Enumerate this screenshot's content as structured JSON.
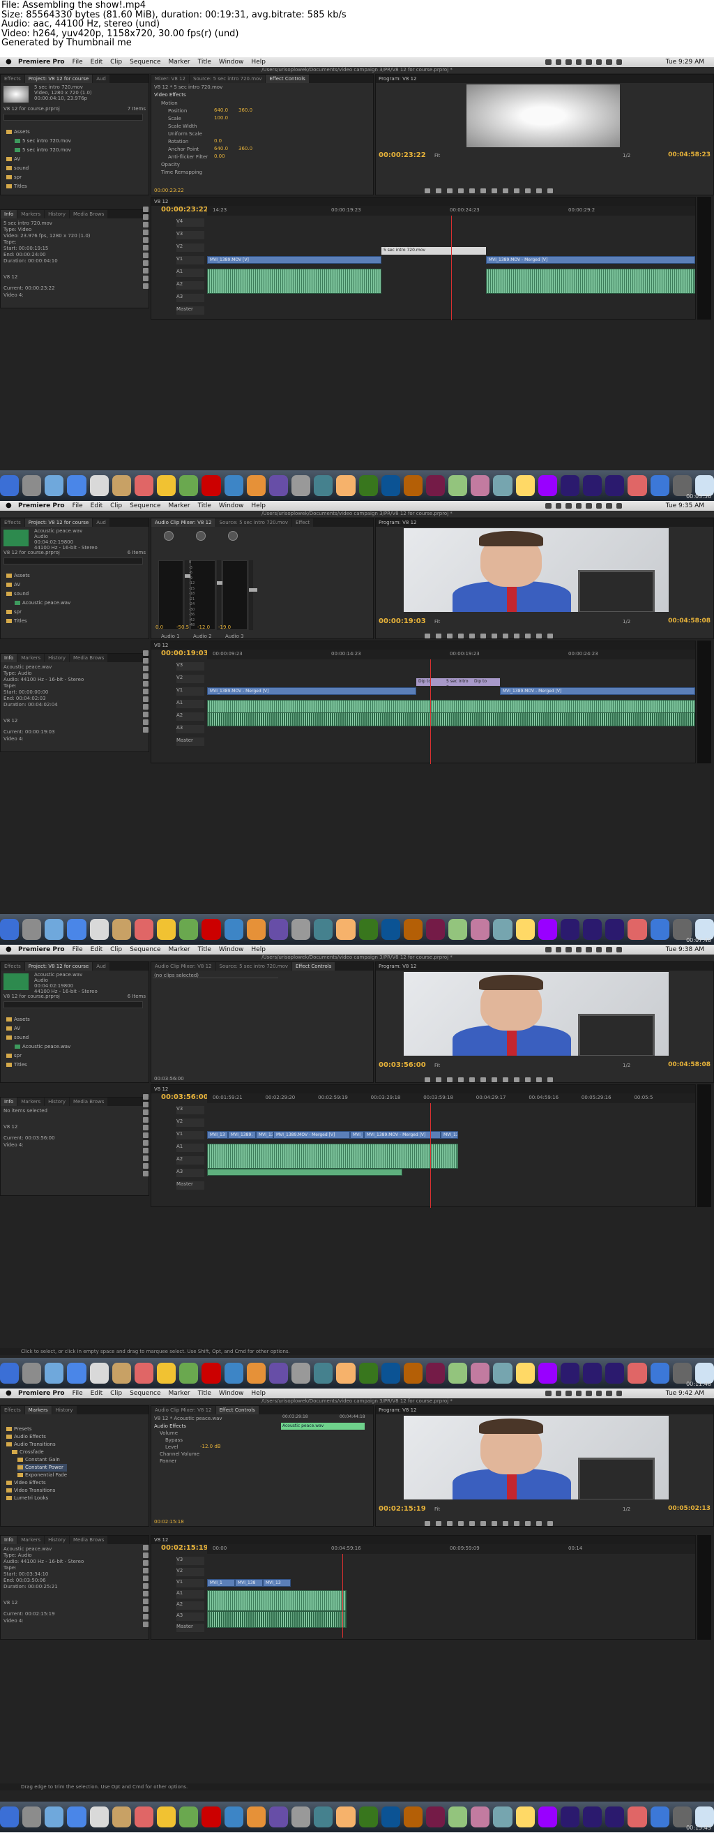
{
  "header": {
    "file": "File: Assembling the show!.mp4",
    "size": "Size: 85564330 bytes (81.60 MiB), duration: 00:19:31, avg.bitrate: 585 kb/s",
    "audio": "Audio: aac, 44100 Hz, stereo (und)",
    "video": "Video: h264, yuv420p, 1158x720, 30.00 fps(r) (und)",
    "generated": "Generated by Thumbnail me"
  },
  "menu": [
    "Premiere Pro",
    "File",
    "Edit",
    "Clip",
    "Sequence",
    "Marker",
    "Title",
    "Window",
    "Help"
  ],
  "path": "/Users/urisoplowek/Documents/video campaign 3/PR/V8 12 for course.prproj *",
  "frames": [
    {
      "clock": "Tue 9:29 AM",
      "stamp": "00:03:56",
      "tabs_left": [
        "Effects",
        "Project: V8 12 for course",
        "Aud"
      ],
      "tabs_mid": [
        "Mixer: V8 12",
        "Source: 5 sec intro 720.mov",
        "Effect Controls"
      ],
      "clip": {
        "name": "5 sec intro 720.mov",
        "info1": "Video, 1280 x 720 (1.0)",
        "info2": "00:00:04:10, 23.976p",
        "project": "V8 12 for course.prproj",
        "items": "7 Items"
      },
      "tree": [
        "Assets",
        "5 sec intro 720.mov",
        "5 sec intro 720.mov",
        "AV",
        "sound",
        "spr",
        "Titles"
      ],
      "fx": {
        "head": "V8 12 * 5 sec intro 720.mov",
        "section": "Video Effects",
        "rows": [
          "Motion",
          "Position",
          "Scale",
          "Scale Width",
          "Uniform Scale",
          "Rotation",
          "Anchor Point",
          "Anti-flicker Filter",
          "Opacity",
          "Time Remapping"
        ],
        "values": [
          "640.0",
          "360.0",
          "100.0",
          "0.0",
          "640.0",
          "360.0",
          "0.00"
        ],
        "tc": "00:00:23:22"
      },
      "program": {
        "label": "Program: V8 12",
        "tc_in": "00:00:23:22",
        "tc_out": "00:04:58:23",
        "fit": "Fit",
        "ratio": "1/2"
      },
      "seq": {
        "name": "V8 12",
        "tc": "00:00:23:22",
        "ticks": [
          "14:23",
          "00:00:19:23",
          "00:00:24:23",
          "00:00:29:2"
        ]
      },
      "title_clip": "5 sec intro 720.mov",
      "vclips": [
        "MVI_1389.MOV [V]",
        "MVI_1389.MOV - Merged [V]"
      ],
      "info": {
        "name": "5 sec intro 720.mov",
        "type": "Type: Video",
        "video": "Video: 23.976 fps, 1280 x 720 (1.0)",
        "tape": "Tape:",
        "start": "Start: 00:00:19:15",
        "end": "End: 00:00:24:00",
        "dur": "Duration: 00:00:04:10",
        "seq": "V8 12",
        "current": "Current: 00:00:23:22",
        "video4": "Video 4:"
      },
      "tracks": [
        "V4",
        "V3",
        "V2",
        "V1",
        "A1",
        "A2",
        "A3",
        "Master"
      ]
    },
    {
      "clock": "Tue 9:35 AM",
      "stamp": "00:07:48",
      "tabs_left": [
        "Effects",
        "Project: V8 12 for course",
        "Aud"
      ],
      "tabs_mid": [
        "Audio Clip Mixer: V8 12",
        "Source: 5 sec intro 720.mov",
        "Effect"
      ],
      "clip": {
        "name": "Acoustic peace.wav",
        "info1": "Audio",
        "info2": "00:04:02:19800",
        "info3": "44100 Hz - 16-bit - Stereo",
        "project": "V8 12 for course.prproj",
        "items": "6 Items"
      },
      "tree": [
        "Assets",
        "AV",
        "sound",
        "Acoustic peace.wav",
        "spr",
        "Titles"
      ],
      "mixer": {
        "vals": [
          "0.0",
          "-50.5",
          "-12.0",
          "-19.0"
        ],
        "lr": [
          "L",
          "R"
        ],
        "tracks": [
          "Audio 1",
          "Audio 2",
          "Audio 3"
        ],
        "scale": [
          "0",
          "-3",
          "-6",
          "-9",
          "-12",
          "-15",
          "-18",
          "-21",
          "-24",
          "-30",
          "-36",
          "-42",
          "-48"
        ]
      },
      "program": {
        "label": "Program: V8 12",
        "tc_in": "00:00:19:03",
        "tc_out": "00:04:58:08",
        "fit": "Fit",
        "ratio": "1/2"
      },
      "seq": {
        "name": "V8 12",
        "tc": "00:00:19:03",
        "ticks": [
          "00:00:09:23",
          "00:00:14:23",
          "00:00:19:23",
          "00:00:24:23"
        ]
      },
      "vclips": [
        "MVI_1389.MOV - Merged [V]",
        "MVI_1389.MOV - Merged [V]"
      ],
      "xclips": [
        "Dip to",
        "5 sec intro 7",
        "Dip to"
      ],
      "info": {
        "name": "Acoustic peace.wav",
        "type": "Type: Audio",
        "audio": "Audio: 44100 Hz - 16-bit - Stereo",
        "tape": "Tape:",
        "start": "Start: 00:00:00:00",
        "end": "End: 00:04:02:03",
        "dur": "Duration: 00:04:02:04",
        "seq": "V8 12",
        "current": "Current: 00:00:19:03",
        "video4": "Video 4:"
      },
      "tracks": [
        "V3",
        "V2",
        "V1",
        "A1",
        "A2",
        "A3",
        "Master"
      ]
    },
    {
      "clock": "Tue 9:38 AM",
      "stamp": "00:11:48",
      "tabs_left": [
        "Effects",
        "Project: V8 12 for course",
        "Aud"
      ],
      "tabs_mid": [
        "Audio Clip Mixer: V8 12",
        "Source: 5 sec intro 720.mov",
        "Effect Controls"
      ],
      "clip": {
        "name": "Acoustic peace.wav",
        "info1": "Audio",
        "info2": "00:04:02:19800",
        "info3": "44100 Hz - 16-bit - Stereo",
        "project": "V8 12 for course.prproj",
        "items": "6 Items"
      },
      "tree": [
        "Assets",
        "AV",
        "sound",
        "Acoustic peace.wav",
        "spr",
        "Titles"
      ],
      "noclip": "(no clips selected)",
      "fx_tc": "00:03:56:00",
      "program": {
        "label": "Program: V8 12",
        "tc_in": "00:03:56:00",
        "tc_out": "00:04:58:08",
        "fit": "Fit",
        "ratio": "1/2"
      },
      "seq": {
        "name": "V8 12",
        "tc": "00:03:56:00",
        "ticks": [
          "00:01:59:21",
          "00:02:29:20",
          "00:02:59:19",
          "00:03:29:18",
          "00:03:59:18",
          "00:04:29:17",
          "00:04:59:16",
          "00:05:29:16",
          "00:05:5"
        ]
      },
      "vclips": [
        "MVI_13",
        "MVI_1389.",
        "MVI_138",
        "MVI_1389.MOV - Merged [V]",
        "MVI_13",
        "MVI_1389.MOV - Merged [V]",
        "MVI_1389"
      ],
      "info": {
        "name": "No items selected",
        "seq": "V8 12",
        "current": "Current: 00:03:56:00",
        "video4": "Video 4:"
      },
      "status": "Click to select, or click in empty space and drag to marquee select. Use Shift, Opt, and Cmd for other options.",
      "tracks": [
        "V3",
        "V2",
        "V1",
        "A1",
        "A2",
        "A3",
        "Master"
      ]
    },
    {
      "clock": "Tue 9:42 AM",
      "stamp": "00:15:43",
      "tabs_left": [
        "Effects",
        "Markers",
        "History"
      ],
      "tabs_mid": [
        "Audio Clip Mixer: V8 12",
        "Effect Controls"
      ],
      "effects_tree": [
        "Presets",
        "Audio Effects",
        "Audio Transitions",
        "Crossfade",
        "Constant Gain",
        "Constant Power",
        "Exponential Fade",
        "Video Effects",
        "Video Transitions",
        "Lumetri Looks"
      ],
      "fx": {
        "head": "V8 12 * Acoustic peace.wav",
        "section": "Audio Effects",
        "rows": [
          "Volume",
          "Bypass",
          "Level",
          "Channel Volume",
          "Panner"
        ],
        "level": "-12.0 dB",
        "clipname": "Acoustic peace.wav",
        "tc_a": "00:03:29:18",
        "tc_b": "00:04:44:18",
        "tc": "00:02:15:18"
      },
      "program": {
        "label": "Program: V8 12",
        "tc_in": "00:02:15:19",
        "tc_out": "00:05:02:13",
        "fit": "Fit",
        "ratio": "1/2"
      },
      "seq": {
        "name": "V8 12",
        "tc": "00:02:15:19",
        "ticks": [
          "00:00",
          "00:04:59:16",
          "00:09:59:09",
          "00:14"
        ]
      },
      "vclips": [
        "MVI_1",
        "MVI_138",
        "MVI_13"
      ],
      "info": {
        "name": "Acoustic peace.wav",
        "type": "Type: Audio",
        "audio": "Audio: 44100 Hz - 16-bit - Stereo",
        "tape": "Tape:",
        "start": "Start: 00:03:34:10",
        "end": "End: 00:03:50:06",
        "dur": "Duration: 00:00:25:21",
        "seq": "V8 12",
        "current": "Current: 00:02:15:19",
        "video4": "Video 4:"
      },
      "status": "Drag edge to trim the selection. Use Opt and Cmd for other options.",
      "tracks": [
        "V3",
        "V2",
        "V1",
        "A1",
        "A2",
        "A3",
        "Master"
      ]
    }
  ],
  "dock_colors": [
    "#3b6fd6",
    "#8c8c8c",
    "#6fa8dc",
    "#4a86e8",
    "#d9d9d9",
    "#c8a165",
    "#e06666",
    "#f1c232",
    "#6aa84f",
    "#cc0000",
    "#3d85c6",
    "#e69138",
    "#674ea7",
    "#999999",
    "#45818e",
    "#f6b26b",
    "#38761d",
    "#0b5394",
    "#b45f06",
    "#741b47",
    "#93c47d",
    "#c27ba0",
    "#76a5af",
    "#ffd966",
    "#9900ff",
    "#2b1a6e",
    "#2b1a6e",
    "#2b1a6e",
    "#e06666",
    "#3c78d8",
    "#666666",
    "#cfe2f3"
  ]
}
